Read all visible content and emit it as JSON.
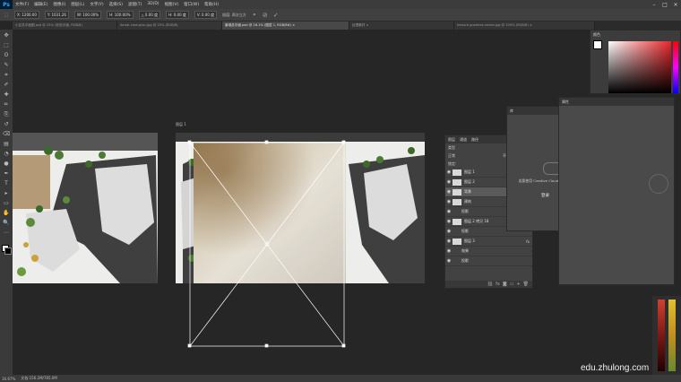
{
  "app": {
    "logo": "Ps"
  },
  "menubar": {
    "items": [
      "文件(F)",
      "编辑(E)",
      "图像(I)",
      "图层(L)",
      "文字(Y)",
      "选择(S)",
      "滤镜(T)",
      "3D(D)",
      "视图(V)",
      "窗口(W)",
      "帮助(H)"
    ],
    "minimize": "–",
    "restore": "□",
    "close": "×"
  },
  "options": {
    "x": "X: 1200.00",
    "y": "Y: 1031.26",
    "w": "W: 100.00%",
    "h": "H: 100.00%",
    "angle": "△ 0.00 度",
    "hskew": "H: 0.00 度",
    "vskew": "V: 0.00 度",
    "interp": "插值: 两次立方",
    "cancel": "⊘",
    "commit": "✓"
  },
  "tabs": [
    {
      "label": "小区总平面图.psd @ 25% (彩色平面, RGB/8)",
      "active": false
    },
    {
      "label": "Aerial-view-plan.jpg @ 25% (RGB/8)",
      "active": false
    },
    {
      "label": "景观总平面.psd @ 16.1% (图层 1, RGB/8#) ×",
      "active": true
    },
    {
      "label": "纹理素材 ×",
      "active": false
    },
    {
      "label": "texture-gradient-vector.jpg @ 100% (RGB/8) ×",
      "active": false
    }
  ],
  "canvas": {
    "layer_label": "图层 1"
  },
  "layers_panel": {
    "tabs": [
      "图层",
      "通道",
      "路径"
    ],
    "kind": "类型",
    "blend": "正常",
    "opacity": "不透明度: 100%",
    "lock": "锁定:",
    "fill": "填充: 100%",
    "rows": [
      {
        "name": "图层 1",
        "indent": 0,
        "fx": ""
      },
      {
        "name": "图层 2",
        "indent": 0,
        "fx": ""
      },
      {
        "name": "背景",
        "indent": 0,
        "fx": ""
      },
      {
        "name": "建筑",
        "indent": 0,
        "fx": "fx"
      },
      {
        "name": "投影",
        "indent": 1,
        "fx": ""
      },
      {
        "name": "图层 2 拷贝 18",
        "indent": 0,
        "fx": "fx"
      },
      {
        "name": "投影",
        "indent": 1,
        "fx": ""
      },
      {
        "name": "图层 3",
        "indent": 0,
        "fx": "fx"
      },
      {
        "name": "效果",
        "indent": 1,
        "fx": ""
      },
      {
        "name": "投影",
        "indent": 1,
        "fx": ""
      }
    ]
  },
  "libraries_panel": {
    "tab": "库",
    "message": "若要使用 Creative Cloud Libraries 请登录",
    "signin": "登录"
  },
  "properties_panel": {
    "tab": "属性"
  },
  "color_panel": {
    "tab": "颜色"
  },
  "statusbar": {
    "zoom": "16.67%",
    "doc": "文档:156.2M/785.0M"
  },
  "watermark": "edu.zhulong.com",
  "colors": {
    "accent": "#31a8ff",
    "bg": "#262626",
    "panel": "#424242"
  }
}
